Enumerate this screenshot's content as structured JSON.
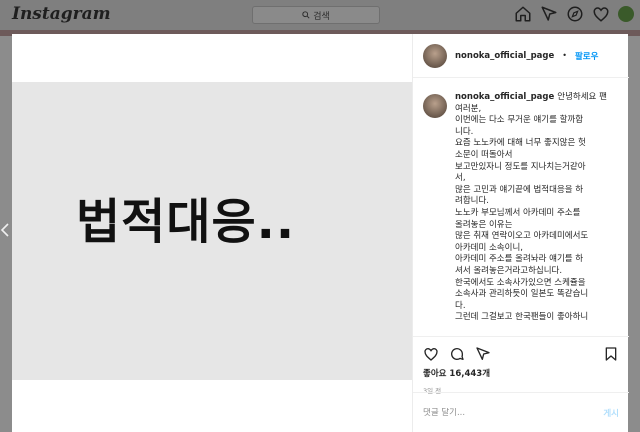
{
  "topbar": {
    "logo": "Instagram",
    "search_placeholder": "검색",
    "icons": [
      "home-icon",
      "direct-icon",
      "explore-icon",
      "heart-icon",
      "profile-avatar"
    ]
  },
  "post": {
    "image_text": "법적대응..",
    "author": "nonoka_official_page",
    "separator": "•",
    "follow_label": "팔로우",
    "caption_lines": [
      "안녕하세요 팬",
      "여러분,",
      "이번에는 다소 무거운 얘기를 할까합",
      "니다.",
      "요즘 노노카에 대해 너무 좋지않은 헛",
      "소문이 떠돌아서",
      "보고만있자니 정도를 지나치는거같아",
      "서,",
      "많은 고민과 얘기끝에 법적대응을 하",
      "려합니다.",
      "노노카 부모님께서 아카데미 주소를",
      "올려놓은 이유는",
      "많은 취재 연락이오고 아카데미에서도",
      "아카데미 소속이니,",
      "아카데미 주소를 올려놔라 얘기를 하",
      "셔서 올려놓은거라고하십니다.",
      "한국에서도 소속사가있으면 스케쥴을",
      "소속사과 관리하듯이 일본도 똑같습니",
      "다.",
      "그런데 그걸보고 한국팬들이 좋아하니"
    ],
    "likes": "좋아요 16,443개",
    "time": "3일 전",
    "comment_placeholder": "댓글 달기...",
    "post_label": "게시"
  },
  "colors": {
    "accent": "#0095f6",
    "post_disabled": "#b2dffc",
    "image_bg": "#e6e6e6"
  }
}
